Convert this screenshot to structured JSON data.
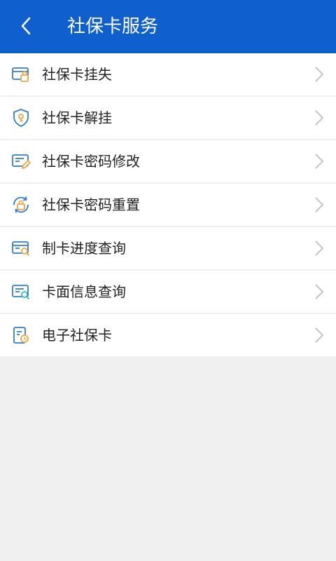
{
  "header": {
    "title": "社保卡服务",
    "back_icon": "chevron-left-icon",
    "color": "#0f5fcf"
  },
  "menu": [
    {
      "label": "社保卡挂失",
      "icon": "card-lock-icon"
    },
    {
      "label": "社保卡解挂",
      "icon": "shield-key-icon"
    },
    {
      "label": "社保卡密码修改",
      "icon": "card-edit-icon"
    },
    {
      "label": "社保卡密码重置",
      "icon": "lock-refresh-icon"
    },
    {
      "label": "制卡进度查询",
      "icon": "card-search-icon"
    },
    {
      "label": "卡面信息查询",
      "icon": "card-info-search-icon"
    },
    {
      "label": "电子社保卡",
      "icon": "e-card-clock-icon"
    }
  ],
  "colors": {
    "accent": "#0f5fcf",
    "icon_blue": "#2f7fd8",
    "icon_orange": "#f2a640",
    "background": "#f0f0f0"
  }
}
